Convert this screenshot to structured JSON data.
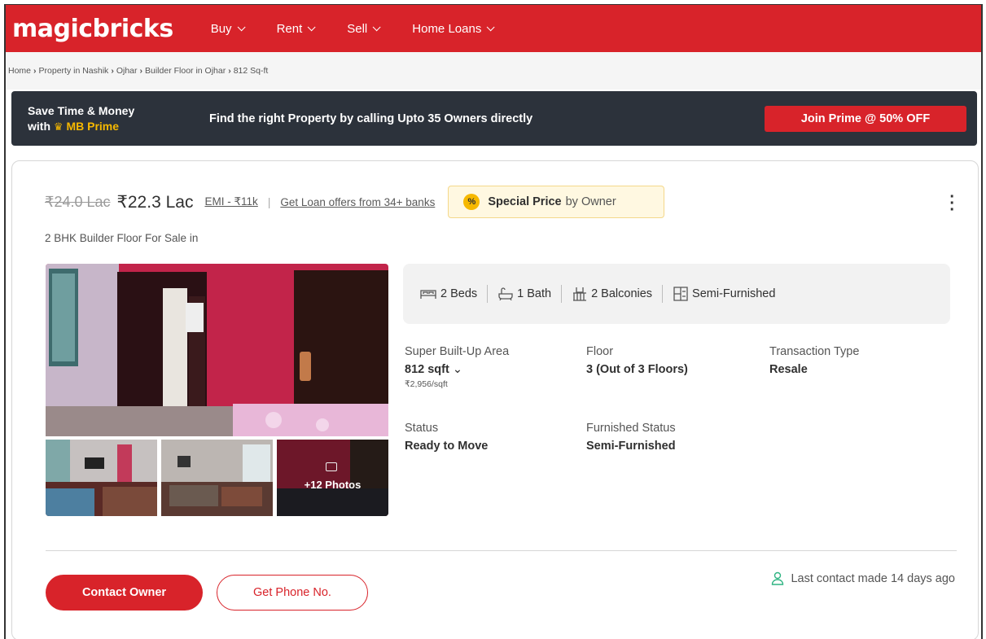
{
  "header": {
    "logo": "magicbricks",
    "nav": [
      {
        "label": "Buy"
      },
      {
        "label": "Rent"
      },
      {
        "label": "Sell"
      },
      {
        "label": "Home Loans"
      }
    ]
  },
  "breadcrumb": [
    "Home",
    "Property in Nashik",
    "Ojhar",
    "Builder Floor in Ojhar",
    "812 Sq-ft"
  ],
  "prime_banner": {
    "line1": "Save Time & Money",
    "line2_prefix": "with",
    "line2_brand": "MB Prime",
    "message": "Find the right Property by calling Upto 35 Owners directly",
    "button": "Join Prime @ 50% OFF"
  },
  "listing": {
    "old_price": "₹24.0 Lac",
    "price": "₹22.3 Lac",
    "emi": "EMI - ₹11k",
    "loan_offers": "Get Loan offers from 34+ banks",
    "special_badge_icon": "%",
    "special_price": "Special Price",
    "special_by": "by Owner",
    "title": "2 BHK Builder Floor For Sale in",
    "more_photos": "+12 Photos",
    "features": [
      {
        "icon": "bed-icon",
        "label": "2 Beds"
      },
      {
        "icon": "bath-icon",
        "label": "1 Bath"
      },
      {
        "icon": "balcony-icon",
        "label": "2 Balconies"
      },
      {
        "icon": "furnishing-icon",
        "label": "Semi-Furnished"
      }
    ],
    "details": {
      "area_label": "Super Built-Up Area",
      "area_value": "812 sqft",
      "area_rate": "₹2,956/sqft",
      "floor_label": "Floor",
      "floor_value": "3 (Out of 3 Floors)",
      "transaction_label": "Transaction Type",
      "transaction_value": "Resale",
      "status_label": "Status",
      "status_value": "Ready to Move",
      "furnished_label": "Furnished Status",
      "furnished_value": "Semi-Furnished"
    },
    "contact_button": "Contact Owner",
    "phone_button": "Get Phone No.",
    "last_contact": "Last contact made 14 days ago"
  },
  "colors": {
    "brand_red": "#d8232a",
    "prime_dark": "#2c323b",
    "prime_gold": "#f6b800",
    "contact_icon": "#2fb482"
  }
}
